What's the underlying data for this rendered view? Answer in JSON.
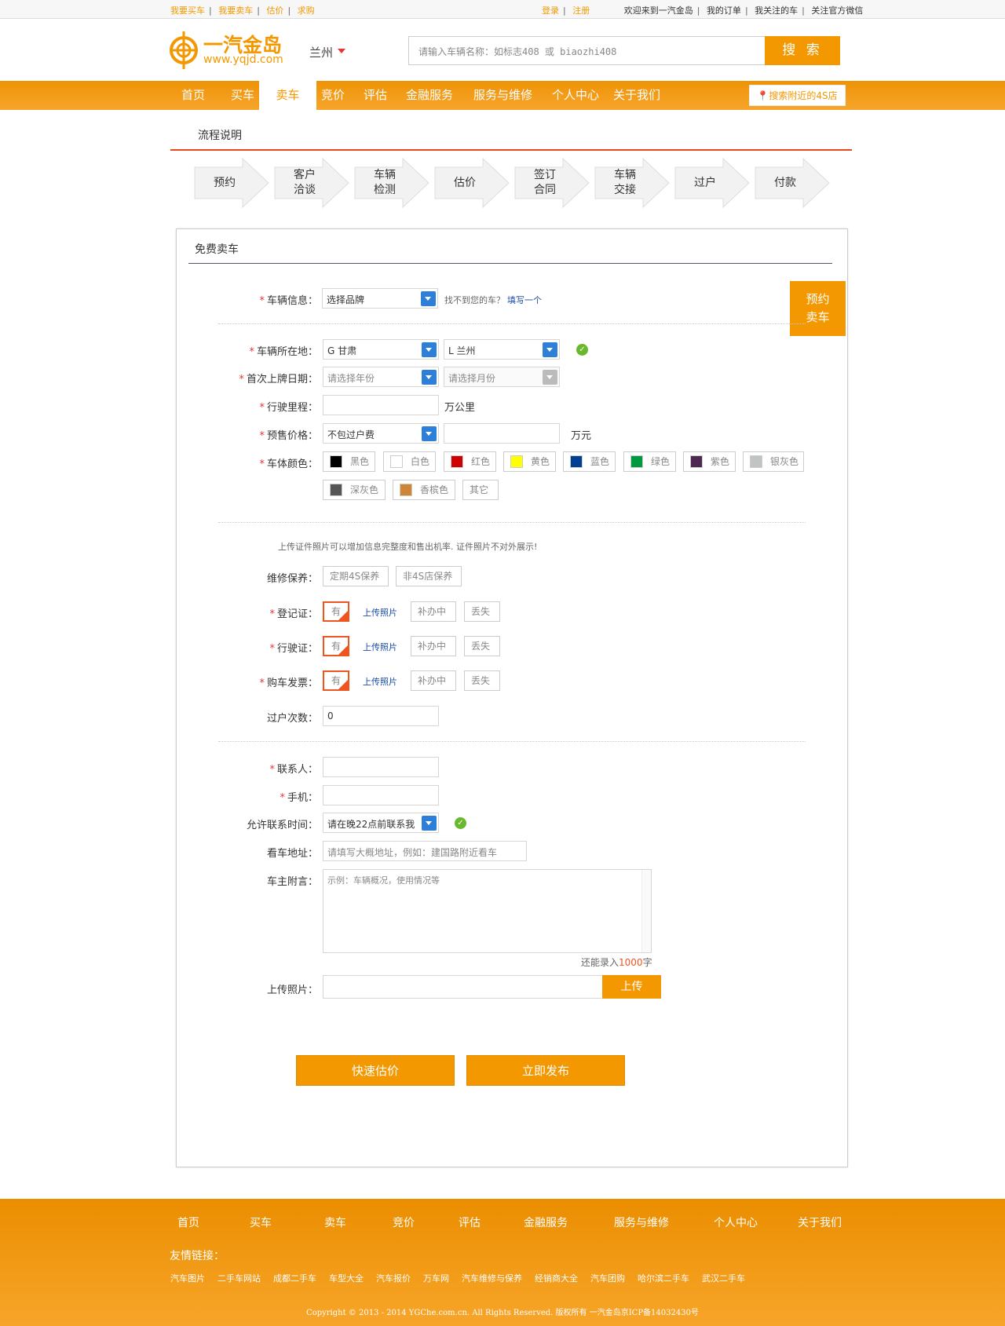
{
  "topbar": {
    "left_links": [
      "我要买车",
      "我要卖车",
      "估价",
      "求购"
    ],
    "login": "登录",
    "register": "注册",
    "right_links": [
      "欢迎来到一汽金岛",
      "我的订单",
      "我关注的车",
      "关注官方微信"
    ]
  },
  "header": {
    "logo_name": "一汽金岛",
    "logo_url": "www.yqjd.com",
    "city": "兰州",
    "search_placeholder": "请输入车辆名称：如标志408 或 biaozhi408",
    "search_button": "搜 索"
  },
  "nav": {
    "items": [
      "首页",
      "买车",
      "卖车",
      "竞价",
      "评估",
      "金融服务",
      "服务与维修",
      "个人中心",
      "关于我们"
    ],
    "active": "卖车",
    "nearby": "搜索附近的4S店"
  },
  "flow": {
    "title": "流程说明",
    "steps": [
      [
        "预约"
      ],
      [
        "客户",
        "洽谈"
      ],
      [
        "车辆",
        "检测"
      ],
      [
        "估价"
      ],
      [
        "签订",
        "合同"
      ],
      [
        "车辆",
        "交接"
      ],
      [
        "过户"
      ],
      [
        "付款"
      ]
    ]
  },
  "form": {
    "title": "免费卖车",
    "side_button": [
      "预约",
      "卖车"
    ],
    "vehicle_info": {
      "label": "车辆信息：",
      "select": "选择品牌",
      "hint": "找不到您的车？",
      "link": "填写一个"
    },
    "location": {
      "label": "车辆所在地：",
      "province": "G 甘肃",
      "city": "L 兰州"
    },
    "reg_date": {
      "label": "首次上牌日期：",
      "year": "请选择年份",
      "month": "请选择月份"
    },
    "mileage": {
      "label": "行驶里程：",
      "value": "",
      "unit": "万公里"
    },
    "price": {
      "label": "预售价格：",
      "select": "不包过户费",
      "value": "",
      "unit": "万元"
    },
    "color": {
      "label": "车体颜色：",
      "options": [
        {
          "name": "黑色",
          "hex": "#000000"
        },
        {
          "name": "白色",
          "hex": "#ffffff"
        },
        {
          "name": "红色",
          "hex": "#d00000"
        },
        {
          "name": "黄色",
          "hex": "#ffff00"
        },
        {
          "name": "蓝色",
          "hex": "#003f91"
        },
        {
          "name": "绿色",
          "hex": "#009a3e"
        },
        {
          "name": "紫色",
          "hex": "#4e2a52"
        },
        {
          "name": "银灰色",
          "hex": "#c0c4c4"
        },
        {
          "name": "深灰色",
          "hex": "#555555"
        },
        {
          "name": "香槟色",
          "hex": "#d08436"
        },
        {
          "name": "其它",
          "hex": ""
        }
      ]
    },
    "doc_note": "上传证件照片可以增加信息完整度和售出机率. 证件照片不对外展示!",
    "maintenance": {
      "label": "维修保养：",
      "options": [
        "定期4S保养",
        "非4S店保养"
      ]
    },
    "docs": [
      {
        "label": "登记证：",
        "has": "有",
        "upload": "上传照片",
        "pending": "补办中",
        "lost": "丢失"
      },
      {
        "label": "行驶证：",
        "has": "有",
        "upload": "上传照片",
        "pending": "补办中",
        "lost": "丢失"
      },
      {
        "label": "购车发票：",
        "has": "有",
        "upload": "上传照片",
        "pending": "补办中",
        "lost": "丢失"
      }
    ],
    "transfers": {
      "label": "过户次数：",
      "value": "0"
    },
    "contact": {
      "label": "联系人：",
      "value": ""
    },
    "phone": {
      "label": "手机：",
      "value": ""
    },
    "contact_time": {
      "label": "允许联系时间：",
      "select": "请在晚22点前联系我"
    },
    "address": {
      "label": "看车地址：",
      "placeholder": "请填写大概地址，例如：建国路附近看车"
    },
    "message": {
      "label": "车主附言：",
      "placeholder": "示例：车辆概况，使用情况等",
      "remain_prefix": "还能录入",
      "remain_count": "1000",
      "remain_suffix": "字"
    },
    "upload": {
      "label": "上传照片：",
      "button": "上传"
    },
    "buttons": {
      "estimate": "快速估价",
      "publish": "立即发布"
    }
  },
  "footer": {
    "nav": [
      "首页",
      "买车",
      "卖车",
      "竞价",
      "评估",
      "金融服务",
      "服务与维修",
      "个人中心",
      "关于我们"
    ],
    "links_title": "友情链接：",
    "links": [
      "汽车图片",
      "二手车网站",
      "成都二手车",
      "车型大全",
      "汽车报价",
      "万车网",
      "汽车维修与保养",
      "经销商大全",
      "汽车团购",
      "哈尔滨二手车",
      "武汉二手车"
    ],
    "copyright": "Copyright © 2013 - 2014 YGChe.com.cn. All Rights Reserved. 版权所有 一汽金岛京ICP备14032430号"
  }
}
